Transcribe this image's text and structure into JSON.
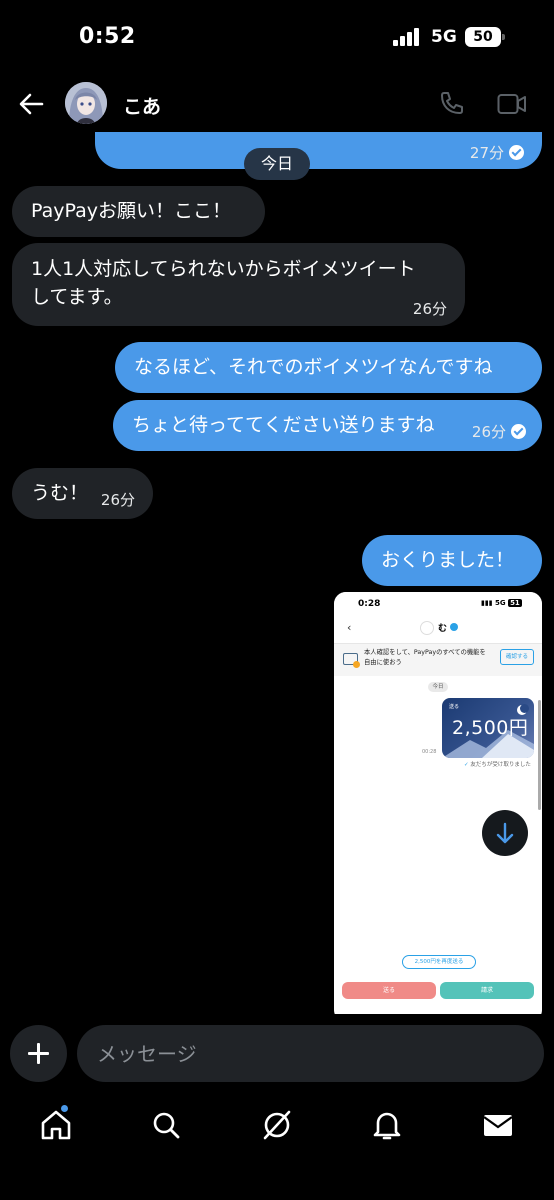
{
  "status_bar": {
    "time": "0:52",
    "network": "5G",
    "battery": "50"
  },
  "header": {
    "contact_name": "こあ"
  },
  "chat": {
    "top_bubble_time": "27分",
    "date_divider": "今日",
    "messages": [
      {
        "side": "in",
        "text": "PayPayお願い！ここ！",
        "time": ""
      },
      {
        "side": "in",
        "text": "1人1人対応してられないからボイメツイートしてます。",
        "time": "26分"
      },
      {
        "side": "out",
        "text": "なるほど、それでのボイメツイなんですね",
        "time": ""
      },
      {
        "side": "out",
        "text": "ちょと待っててください送りますね",
        "time": "26分"
      },
      {
        "side": "in",
        "text": "うむ！",
        "time": "26分"
      },
      {
        "side": "out",
        "text": "おくりました！",
        "time": ""
      }
    ],
    "line1a": "1人1人対応してられないからボイメツイート",
    "line1b": "してます。"
  },
  "attachment": {
    "time": "0:28",
    "network": "5G",
    "battery": "51",
    "contact": "む",
    "banner_text": "本人確認をして、PayPayのすべての機能を自由に使おう",
    "banner_button": "確認する",
    "date": "今日",
    "card_label": "送る",
    "amount": "2,500円",
    "card_time": "00:28",
    "received_text": "友だちが受け取りました",
    "resend_button": "2,500円を再度送る",
    "send_button": "送る",
    "request_button": "請求"
  },
  "composer": {
    "placeholder": "メッセージ"
  },
  "tabs": [
    "home-icon",
    "search-icon",
    "grok-icon",
    "bell-icon",
    "mail-icon"
  ],
  "colors": {
    "outgoing_bubble": "#4a99e9",
    "incoming_bubble": "#202327",
    "accent": "#4a99e9"
  }
}
